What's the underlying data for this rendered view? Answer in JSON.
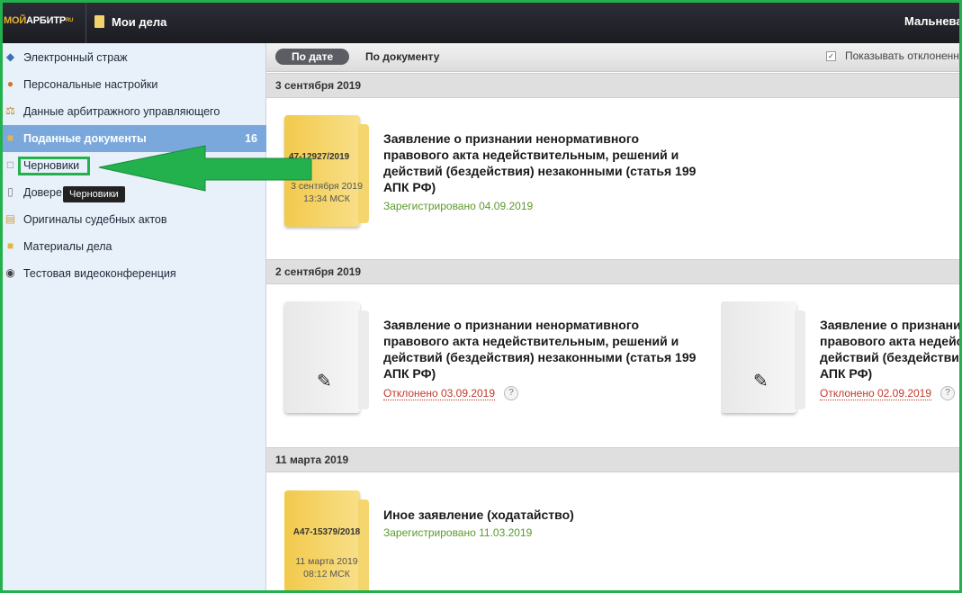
{
  "header": {
    "logo_part1": "МОЙ",
    "logo_part2": "АРБИТР",
    "logo_part3": "RU",
    "cases_label": "Мои дела",
    "user_name": "Мальнева"
  },
  "sidebar": {
    "items": [
      {
        "label": "Электронный страж",
        "icon": "shield-icon"
      },
      {
        "label": "Персональные настройки",
        "icon": "user-icon"
      },
      {
        "label": "Данные арбитражного управляющего",
        "icon": "scales-icon"
      },
      {
        "label": "Поданные документы",
        "icon": "inbox-icon",
        "count": "16"
      },
      {
        "label": "Черновики",
        "icon": "draft-icon"
      },
      {
        "label": "Доверенности",
        "icon": "doc-icon"
      },
      {
        "label": "Оригиналы судебных актов",
        "icon": "archive-icon"
      },
      {
        "label": "Материалы дела",
        "icon": "folder-icon"
      },
      {
        "label": "Тестовая видеоконференция",
        "icon": "webcam-icon"
      }
    ],
    "tooltip": "Черновики",
    "doverennosti_visible": "Довере"
  },
  "filterbar": {
    "by_date": "По дате",
    "by_document": "По документу",
    "show_rejected": "Показывать отклоненн"
  },
  "groups": [
    {
      "date": "3 сентября 2019",
      "cards": [
        {
          "case_no": "А47-12927/2019",
          "case_date": "3 сентября 2019",
          "case_time": "13:34 МСК",
          "title": "Заявление о признании ненормативного правового акта недействительным, решений и действий (бездействия) незаконными (статья 199 АПК РФ)",
          "status": "Зарегистрировано 04.09.2019"
        }
      ]
    },
    {
      "date": "2 сентября 2019",
      "cards": [
        {
          "title": "Заявление о признании ненормативного правового акта недействительным, решений и действий (бездействия) незаконными (статья 199 АПК РФ)",
          "status": "Отклонено 03.09.2019",
          "help": "?"
        },
        {
          "title": "Заявление о признании ненормативного правового акта недействительным, решений и действий (бездействия) незаконными (статья 199 АПК РФ)",
          "status": "Отклонено 02.09.2019",
          "help": "?"
        }
      ]
    },
    {
      "date": "11 марта 2019",
      "cards": [
        {
          "case_no": "А47-15379/2018",
          "case_date": "11 марта 2019",
          "case_time": "08:12 МСК",
          "title": "Иное заявление (ходатайство)",
          "status": "Зарегистрировано 11.03.2019"
        }
      ]
    }
  ],
  "colors": {
    "highlight": "#22b14c",
    "sidebar_active": "#7aa8dc",
    "status_ok": "#5a9a2a",
    "status_rejected": "#c0392b"
  }
}
